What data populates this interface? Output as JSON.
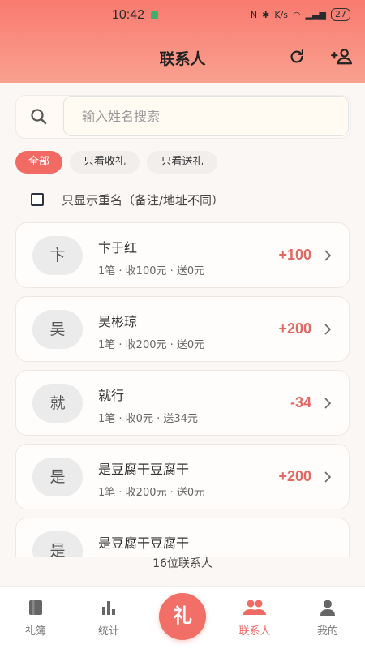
{
  "status": {
    "time": "10:42",
    "network": "K/s",
    "battery": "27"
  },
  "header": {
    "title": "联系人"
  },
  "search": {
    "placeholder": "输入姓名搜索"
  },
  "filters": [
    {
      "label": "全部",
      "active": true
    },
    {
      "label": "只看收礼",
      "active": false
    },
    {
      "label": "只看送礼",
      "active": false
    }
  ],
  "duplicate_filter": {
    "label": "只显示重名（备注/地址不同）",
    "checked": false
  },
  "contacts": [
    {
      "avatar": "卞",
      "name": "卞于红",
      "meta": "1笔 · 收100元 · 送0元",
      "amount": "+100"
    },
    {
      "avatar": "吴",
      "name": "吴彬琼",
      "meta": "1笔 · 收200元 · 送0元",
      "amount": "+200"
    },
    {
      "avatar": "就",
      "name": "就行",
      "meta": "1笔 · 收0元 · 送34元",
      "amount": "-34"
    },
    {
      "avatar": "是",
      "name": "是豆腐干豆腐干",
      "meta": "1笔 · 收200元 · 送0元",
      "amount": "+200"
    },
    {
      "avatar": "是",
      "name": "是豆腐干豆腐干",
      "meta": "",
      "amount": ""
    }
  ],
  "summary": {
    "total": "16位联系人"
  },
  "nav": {
    "items": [
      {
        "label": "礼簿",
        "icon": "book-icon"
      },
      {
        "label": "统计",
        "icon": "bar-chart-icon"
      },
      {
        "label": "联系人",
        "icon": "people-icon",
        "active": true
      },
      {
        "label": "我的",
        "icon": "person-icon"
      }
    ],
    "fab_label": "礼"
  },
  "colors": {
    "accent": "#f16a63",
    "header_top": "#f97a6f",
    "header_bottom": "#f9a18f",
    "amount": "#e06a63"
  }
}
